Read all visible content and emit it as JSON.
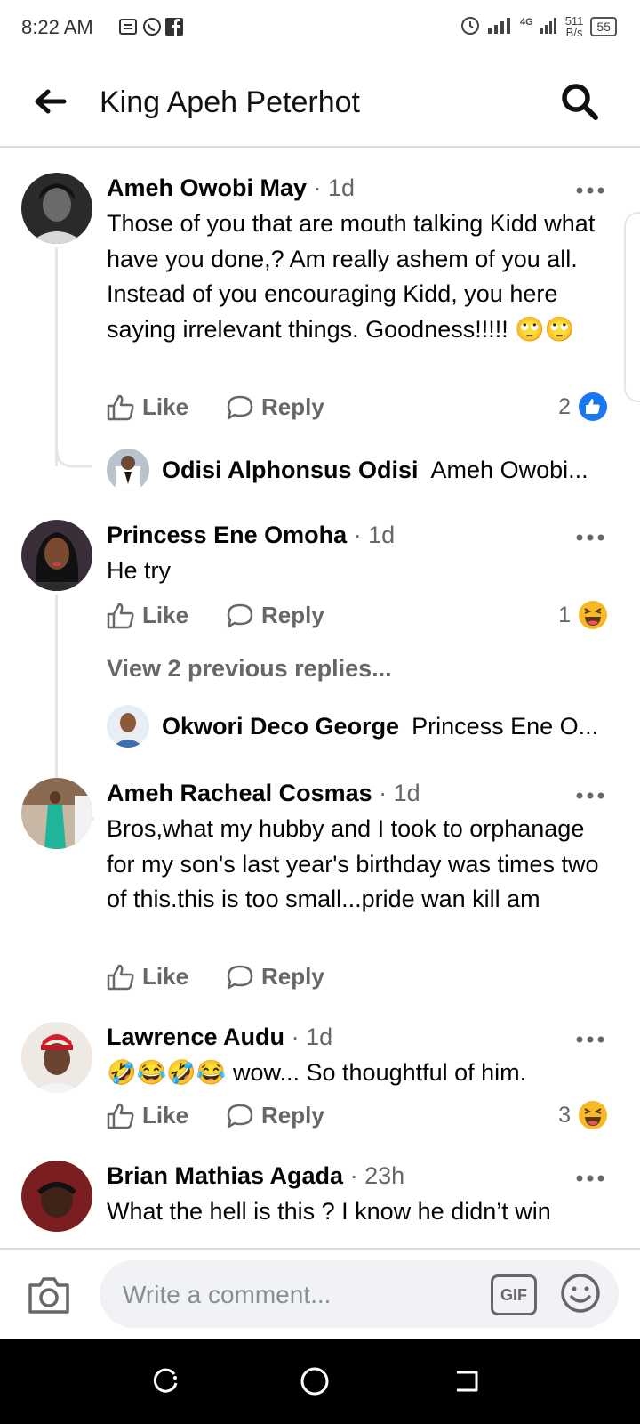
{
  "status": {
    "time": "8:22 AM",
    "net_type": "4G",
    "speed_value": "511",
    "speed_unit": "B/s",
    "battery": "55"
  },
  "header": {
    "title": "King Apeh Peterhot"
  },
  "comments": [
    {
      "name": "Ameh Owobi May",
      "time": "· 1d",
      "text": "Those of you that are mouth talking Kidd what have you done,? Am really ashem of you all. Instead of you encouraging Kidd, you here saying irrelevant things. Goodness!!!!! 🙄🙄",
      "like_label": "Like",
      "reply_label": "Reply",
      "reaction_count": "2",
      "reaction_icon": "like",
      "reply": {
        "name": "Odisi Alphonsus Odisi",
        "preview": "Ameh Owobi..."
      }
    },
    {
      "name": "Princess Ene Omoha",
      "time": "· 1d",
      "text": "He try",
      "like_label": "Like",
      "reply_label": "Reply",
      "reaction_count": "1",
      "reaction_icon": "haha",
      "view_previous": "View 2 previous replies...",
      "reply": {
        "name": "Okwori Deco George",
        "preview": "Princess Ene O..."
      }
    },
    {
      "name": "Ameh Racheal Cosmas",
      "time": "· 1d",
      "text": "Bros,what my hubby and I took to orphanage for my son's last year's birthday was times two of this.this is too small...pride wan kill am",
      "like_label": "Like",
      "reply_label": "Reply"
    },
    {
      "name": "Lawrence Audu",
      "time": "· 1d",
      "text": "🤣😂🤣😂 wow... So thoughtful of him.",
      "like_label": "Like",
      "reply_label": "Reply",
      "reaction_count": "3",
      "reaction_icon": "haha"
    },
    {
      "name": "Brian Mathias Agada",
      "time": "· 23h",
      "text": "What the hell is this ? I know he didn’t win"
    }
  ],
  "composer": {
    "placeholder": "Write a comment...",
    "gif_label": "GIF"
  },
  "icons": {
    "back": "arrow-left-icon",
    "search": "search-icon",
    "more": "more-icon",
    "like": "thumbs-up-icon",
    "reply": "comment-bubble-icon",
    "camera": "camera-icon",
    "emoji": "emoji-icon"
  },
  "colors": {
    "like_blue": "#1877f2",
    "haha_yellow": "#f7b928",
    "muted": "#65676b"
  }
}
